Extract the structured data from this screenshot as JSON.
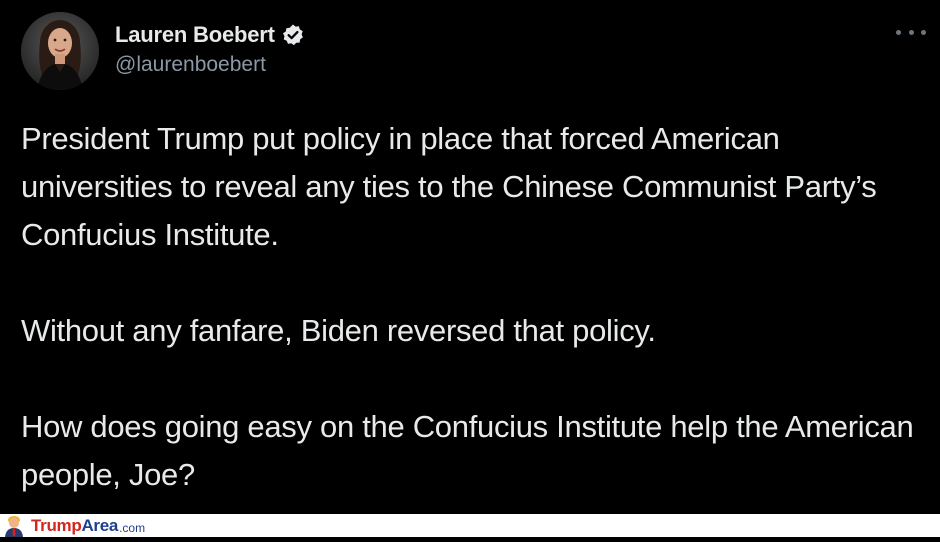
{
  "tweet": {
    "author": {
      "display_name": "Lauren Boebert",
      "handle": "@laurenboebert",
      "verified": true,
      "avatar_icon": "profile-photo"
    },
    "more_icon": "ellipsis-icon",
    "paragraphs": [
      "President Trump put policy in place that forced American universities to reveal any ties to the Chinese Communist Party’s Confucius Institute.",
      "Without any fanfare, Biden reversed that policy.",
      "How does going easy on the Confucius Institute help the American people, Joe?"
    ]
  },
  "watermark": {
    "part1": "Trump",
    "part2": "Area",
    "part3": ".com",
    "colors": {
      "trump": "#d4261c",
      "area": "#1f3f8f"
    }
  },
  "colors": {
    "background": "#000000",
    "primary_text": "#e7e9ea",
    "secondary_text": "#8b98a5",
    "verified_badge": "#e7e9ea"
  }
}
